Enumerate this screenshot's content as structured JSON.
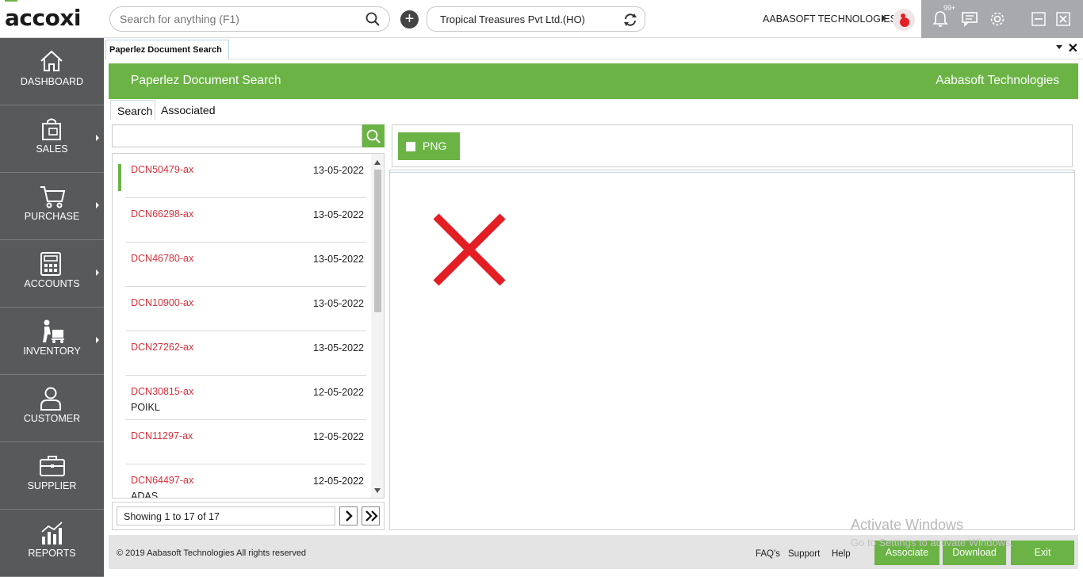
{
  "app": {
    "logo": "accoxi",
    "search_placeholder": "Search for anything (F1)",
    "company": "Tropical Treasures Pvt Ltd.(HO)",
    "organization": "AABASOFT TECHNOLOGIES",
    "notification_badge": "99+"
  },
  "sidebar": {
    "items": [
      {
        "label": "DASHBOARD",
        "icon": "home-icon",
        "has_submenu": false
      },
      {
        "label": "SALES",
        "icon": "shopping-bag-icon",
        "has_submenu": true
      },
      {
        "label": "PURCHASE",
        "icon": "cart-icon",
        "has_submenu": true
      },
      {
        "label": "ACCOUNTS",
        "icon": "calculator-icon",
        "has_submenu": true
      },
      {
        "label": "INVENTORY",
        "icon": "inventory-icon",
        "has_submenu": true
      },
      {
        "label": "CUSTOMER",
        "icon": "person-icon",
        "has_submenu": false
      },
      {
        "label": "SUPPLIER",
        "icon": "briefcase-icon",
        "has_submenu": false
      },
      {
        "label": "REPORTS",
        "icon": "chart-icon",
        "has_submenu": false
      }
    ]
  },
  "tab": {
    "label": "Paperlez Document Search"
  },
  "header": {
    "title": "Paperlez Document Search",
    "company": "Aabasoft Technologies"
  },
  "subtabs": {
    "search": "Search",
    "associated": "Associated"
  },
  "documents": [
    {
      "id": "DCN50479-ax",
      "date": "13-05-2022",
      "sub": "",
      "selected": true
    },
    {
      "id": "DCN66298-ax",
      "date": "13-05-2022",
      "sub": ""
    },
    {
      "id": "DCN46780-ax",
      "date": "13-05-2022",
      "sub": ""
    },
    {
      "id": "DCN10900-ax",
      "date": "13-05-2022",
      "sub": ""
    },
    {
      "id": "DCN27262-ax",
      "date": "13-05-2022",
      "sub": ""
    },
    {
      "id": "DCN30815-ax",
      "date": "12-05-2022",
      "sub": "POIKL"
    },
    {
      "id": "DCN11297-ax",
      "date": "12-05-2022",
      "sub": ""
    },
    {
      "id": "DCN64497-ax",
      "date": "12-05-2022",
      "sub": "ADAS"
    }
  ],
  "pager": {
    "info": "Showing 1 to 17 of 17"
  },
  "viewer": {
    "format_label": "PNG"
  },
  "footer": {
    "copyright": "© 2019 Aabasoft Technologies All rights reserved",
    "links": [
      "FAQ's",
      "Support",
      "Help"
    ],
    "buttons": {
      "associate": "Associate",
      "download": "Download",
      "exit": "Exit"
    }
  },
  "watermark": {
    "line1": "Activate Windows",
    "line2": "Go to Settings to activate Windows."
  },
  "colors": {
    "accent_green": "#6ab344",
    "sidebar": "#58595b",
    "doc_id_red": "#d6323c",
    "error_x": "#e31e24"
  }
}
